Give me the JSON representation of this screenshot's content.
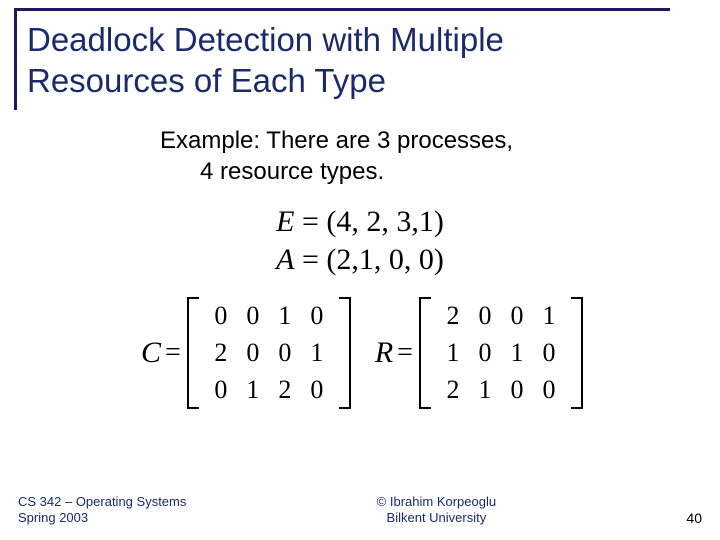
{
  "title_line1": "Deadlock Detection with Multiple",
  "title_line2": "Resources of Each Type",
  "example_line1": "Example: There are 3 processes,",
  "example_line2": "4 resource types.",
  "vectors": {
    "E_label": "E",
    "E_eq": " = (4, 2, 3,1)",
    "A_label": "A",
    "A_eq": " = (2,1, 0, 0)"
  },
  "matrixC": {
    "label": "C",
    "eq": "=",
    "cells": [
      "0",
      "0",
      "1",
      "0",
      "2",
      "0",
      "0",
      "1",
      "0",
      "1",
      "2",
      "0"
    ]
  },
  "matrixR": {
    "label": "R",
    "eq": "=",
    "cells": [
      "2",
      "0",
      "0",
      "1",
      "1",
      "0",
      "1",
      "0",
      "2",
      "1",
      "0",
      "0"
    ]
  },
  "footer": {
    "left1": "CS 342 – Operating Systems",
    "left2": "Spring 2003",
    "center1": "© Ibrahim Korpeoglu",
    "center2": "Bilkent University",
    "page": "40"
  }
}
